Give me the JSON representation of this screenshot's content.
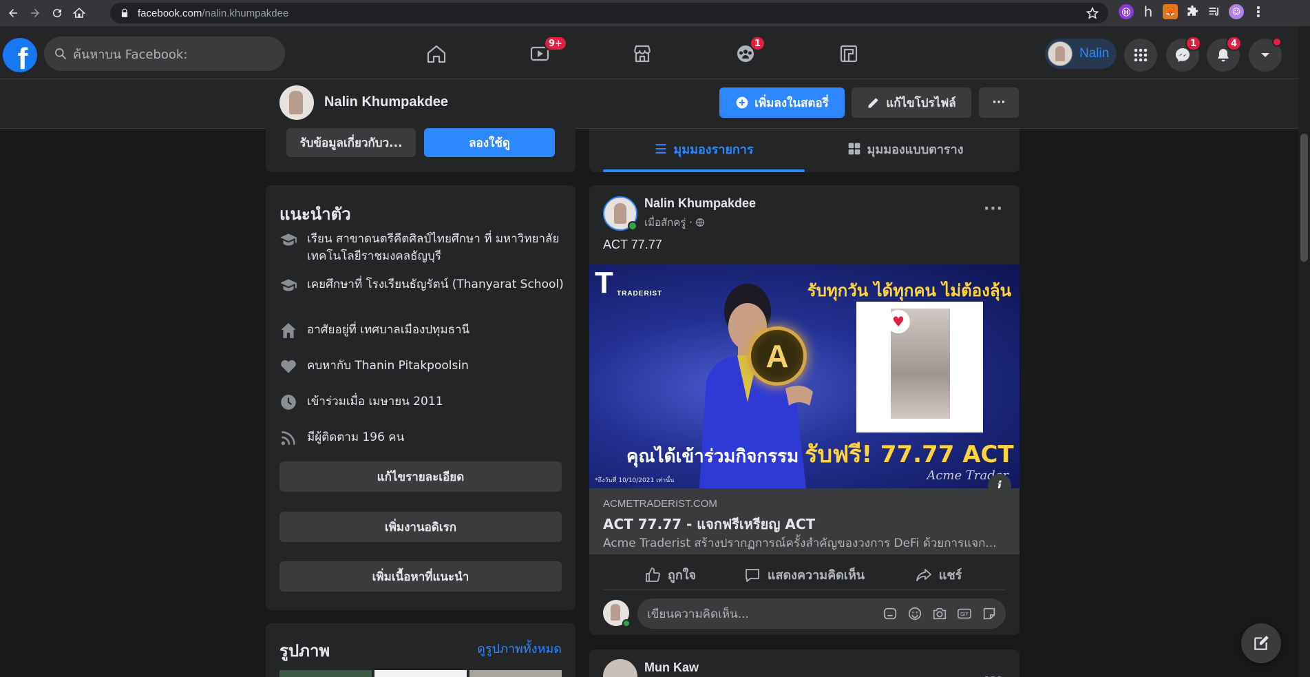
{
  "browser": {
    "url_host": "facebook.com",
    "url_path": "/nalin.khumpakdee"
  },
  "header": {
    "logo": "f",
    "search_placeholder": "ค้นหาบน Facebook:",
    "badges": {
      "watch": "9+",
      "groups": "1",
      "messenger": "1",
      "notifications": "4"
    },
    "profile_chip_name": "Nalin"
  },
  "profile_bar": {
    "name": "Nalin Khumpakdee",
    "add_story": "เพิ่มลงในสตอรี่",
    "edit_profile": "แก้ไขโปรไฟล์",
    "more": "···"
  },
  "left_top": {
    "info_btn": "รับข้อมูลเกี่ยวกับว...",
    "try_btn": "ลองใช้ดู"
  },
  "intro": {
    "title": "แนะนำตัว",
    "items": [
      {
        "icon": "graduation-cap-icon",
        "text": "เรียน สาขาดนตรีคีตศิลป์ไทยศึกษา ที่ มหาวิทยาลัยเทคโนโลยีราชมงคลธัญบุรี"
      },
      {
        "icon": "graduation-cap-icon",
        "text": "เคยศึกษาที่ โรงเรียนธัญรัตน์ (Thanyarat School)"
      },
      {
        "icon": "home-icon",
        "text": "อาศัยอยู่ที่ เทศบาลเมืองปทุมธานี"
      },
      {
        "icon": "heart-icon",
        "text": "คบหากับ Thanin Pitakpoolsin"
      },
      {
        "icon": "clock-icon",
        "text": "เข้าร่วมเมื่อ เมษายน 2011"
      },
      {
        "icon": "rss-icon",
        "text": "มีผู้ติดตาม 196 คน"
      }
    ],
    "edit_details": "แก้ไขรายละเอียด",
    "add_hobbies": "เพิ่มงานอดิเรก",
    "add_featured": "เพิ่มเนื้อหาที่แนะนำ"
  },
  "photos": {
    "title": "รูปภาพ",
    "see_all": "ดูรูปภาพทั้งหมด"
  },
  "tabs": {
    "list_view": "มุมมองรายการ",
    "grid_view": "มุมมองแบบตาราง"
  },
  "post": {
    "author": "Nalin Khumpakdee",
    "time": "เมื่อสักครู่ ·",
    "text": "ACT 77.77",
    "ad": {
      "brand": "TRADERIST",
      "headline": "รับทุกวัน ได้ทุกคน ไม่ต้องลุ้น",
      "cta_prefix": "คุณได้เข้าร่วมกิจกรรม",
      "cta_highlight": "รับฟรี! 77.77 ACT",
      "footnote": "*ถึงวันที่ 10/10/2021 เท่านั้น",
      "signature": "Acme Trader"
    },
    "link": {
      "domain": "ACMETRADERIST.COM",
      "title": "ACT 77.77 - แจกฟรีเหรียญ ACT",
      "description": "Acme Traderist สร้างปรากฏการณ์ครั้งสำคัญของวงการ DeFi ด้วยการแจก..."
    },
    "actions": {
      "like": "ถูกใจ",
      "comment": "แสดงความคิดเห็น",
      "share": "แชร์"
    },
    "comment_placeholder": "เขียนความคิดเห็น..."
  },
  "post2": {
    "author": "Mun Kaw"
  }
}
